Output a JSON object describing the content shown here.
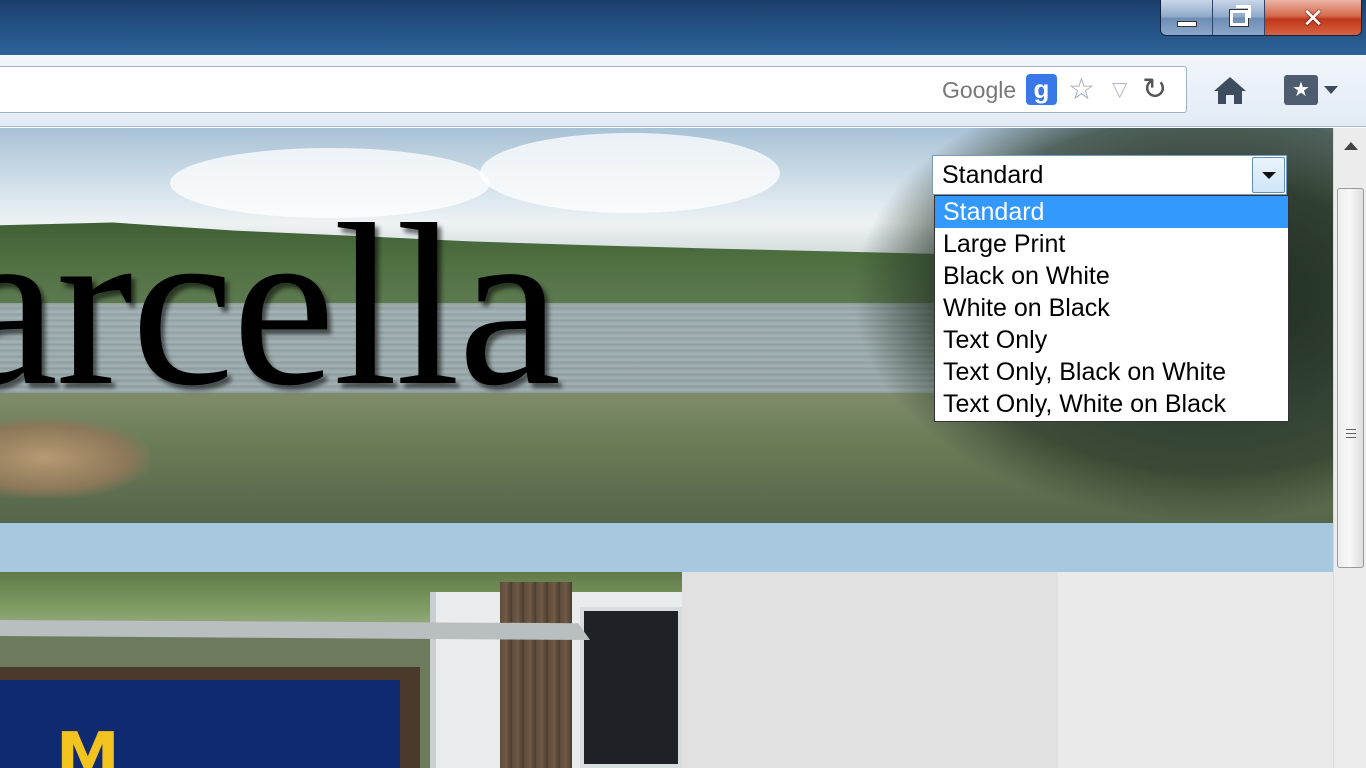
{
  "window": {
    "controls": {
      "minimize_icon": "minimize-icon",
      "restore_icon": "restore-icon",
      "close_icon": "close-icon",
      "close_glyph": "✕"
    }
  },
  "toolbar": {
    "search_engine_label": "Google",
    "search_engine_badge": "g",
    "star_icon": "☆",
    "dropmarker_icon": "▽",
    "reload_icon": "↻",
    "bookmarks_icon": "★"
  },
  "page": {
    "site_title": "arcella",
    "sign_text": "M"
  },
  "style_select": {
    "selected": "Standard",
    "options": [
      "Standard",
      "Large Print",
      "Black on White",
      "White on Black",
      "Text Only",
      "Text Only, Black on White",
      "Text Only, White on Black"
    ],
    "highlight_color": "#3399ff"
  },
  "colors": {
    "nav_bar": "#a8c8e0",
    "titlebar": "#245486"
  }
}
